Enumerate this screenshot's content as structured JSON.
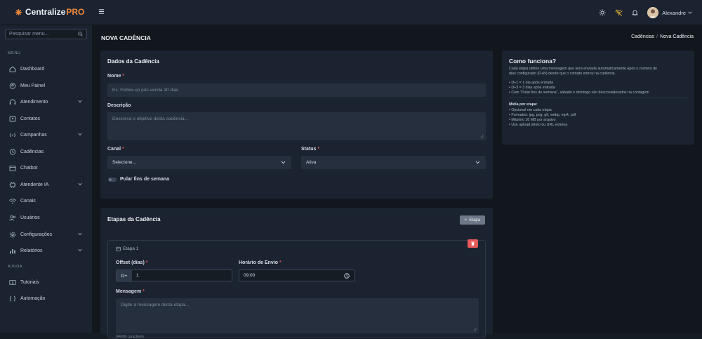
{
  "header": {
    "logo_main": "Centralize",
    "logo_accent": "PRO",
    "user_name": "Alexandre"
  },
  "sidebar": {
    "search_placeholder": "Pesquisar menu...",
    "section_menu": "MENU",
    "section_help": "AJUDA",
    "items": [
      {
        "label": "Dashboard",
        "icon": "home-icon"
      },
      {
        "label": "Meu Painel",
        "icon": "user-circle-icon"
      },
      {
        "label": "Atendimento",
        "icon": "headset-icon",
        "expandable": true
      },
      {
        "label": "Contatos",
        "icon": "contacts-icon"
      },
      {
        "label": "Campanhas",
        "icon": "broadcast-icon",
        "expandable": true
      },
      {
        "label": "Cadências",
        "icon": "clock-icon"
      },
      {
        "label": "Chatbot",
        "icon": "calendar-icon"
      },
      {
        "label": "Atendente IA",
        "icon": "ai-icon",
        "expandable": true
      },
      {
        "label": "Canais",
        "icon": "wifi-icon"
      },
      {
        "label": "Usuários",
        "icon": "users-icon"
      },
      {
        "label": "Configurações",
        "icon": "gear-icon",
        "expandable": true
      },
      {
        "label": "Relatórios",
        "icon": "bar-chart-icon",
        "expandable": true
      }
    ],
    "help_items": [
      {
        "label": "Tutoriais",
        "icon": "book-icon"
      },
      {
        "label": "Automação",
        "icon": "braces-icon"
      }
    ]
  },
  "page": {
    "title": "NOVA CADÊNCIA",
    "breadcrumb_parent": "Cadências",
    "breadcrumb_separator": "/",
    "breadcrumb_current": "Nova Cadência"
  },
  "dados": {
    "title": "Dados da Cadência",
    "nome_label": "Nome",
    "nome_placeholder": "Ex: Follow-up pós-venda 30 dias",
    "descricao_label": "Descrição",
    "descricao_placeholder": "Descreva o objetivo desta cadência...",
    "canal_label": "Canal",
    "canal_value": "Selecione...",
    "status_label": "Status",
    "status_value": "Ativa",
    "pular_label": "Pular fins de semana",
    "required_mark": "*"
  },
  "como": {
    "title": "Como funciona?",
    "p1": "Cada etapa define uma mensagem que será enviada automaticamente após o número de",
    "p2": "dias configurado (D+N) desde que o contato entrou na cadência.",
    "bullets1": [
      "D+1 = 1 dia após entrada",
      "D+3 = 3 dias após entrada",
      "Com \"Pular fins de semana\", sábado e domingo são desconsiderados na contagem"
    ],
    "midia_title": "Mídia por etapa:",
    "bullets2": [
      "Opcional em cada etapa",
      "Formatos: jpg, png, gif, webp, mp4, pdf",
      "Máximo 16 MB por arquivo",
      "Use upload direto ou URL externa"
    ]
  },
  "etapas": {
    "title": "Etapas da Cadência",
    "add_button": "Etapa",
    "step_title": "Etapa 1",
    "offset_label": "Offset (dias)",
    "offset_prefix": "D+",
    "offset_value": "1",
    "horario_label": "Horário de Envio",
    "horario_value": "09:00",
    "mensagem_label": "Mensagem",
    "mensagem_placeholder": "Digite a mensagem desta etapa...",
    "char_count": "0/4096 caracteres"
  },
  "colors": {
    "accent": "#f08a3c",
    "danger": "#e85a5a",
    "required": "#e0525d"
  }
}
